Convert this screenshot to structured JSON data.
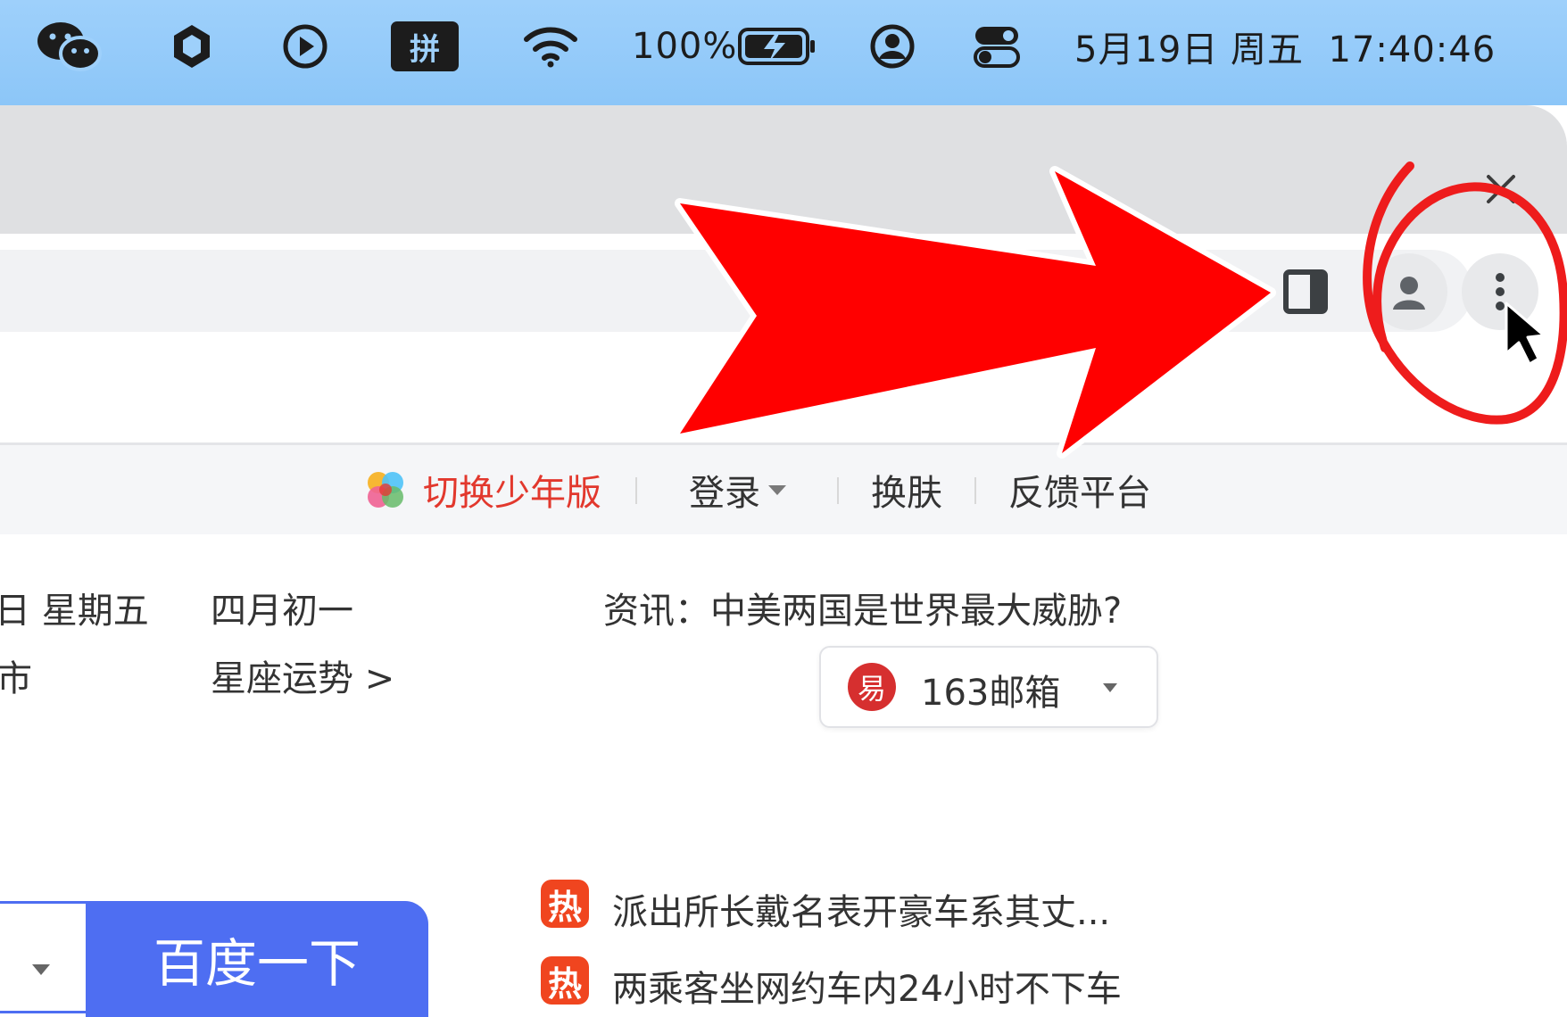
{
  "menubar": {
    "battery_text": "100%",
    "ime_label": "拼",
    "datetime": "5月19日 周五  17:40:46",
    "icons": [
      "wechat-icon",
      "hexagon-icon",
      "play-circle-icon",
      "wifi-icon",
      "battery-charging-icon",
      "user-circle-icon",
      "control-center-icon"
    ]
  },
  "baidu_nav": {
    "switch_label": "切换少年版",
    "login_label": "登录",
    "skin_label": "换肤",
    "feedback_label": "反馈平台"
  },
  "info": {
    "date_fragment": "日  星期五",
    "lunar": "四月初一",
    "city_fragment": "市",
    "horoscope": "星座运势 >",
    "news": "资讯：中美两国是世界最大威胁?"
  },
  "mail": {
    "logo_char": "易",
    "label": "163邮箱"
  },
  "hot": {
    "badge": "热",
    "items": [
      "派出所长戴名表开豪车系其丈...",
      "两乘客坐网约车内24小时不下车"
    ]
  },
  "search": {
    "button_label": "百度一下"
  },
  "colors": {
    "menubar": "#9ed0fb",
    "baidu_blue": "#4e6ef2",
    "annotation_red": "#ff0000",
    "switch_red": "#e2382d",
    "hot_orange": "#f0451f"
  }
}
